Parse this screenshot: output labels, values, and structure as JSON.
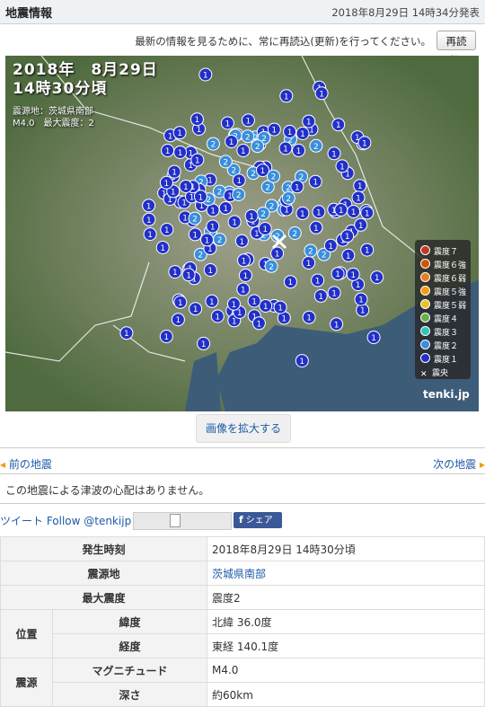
{
  "header": {
    "title": "地震情報",
    "issued": "2018年8月29日 14時34分発表"
  },
  "notice": {
    "message": "最新の情報を見るために、常に再読込(更新)を行ってください。",
    "reload_label": "再読込"
  },
  "map": {
    "date_line1": "2018年　8月29日",
    "date_line2": "14時30分頃",
    "epicenter_line": "震源地：茨城県南部",
    "magnitude_line": "M4.0　最大震度：2",
    "legend": [
      {
        "label": "震度７",
        "color": "#c0392b",
        "glyph": "7"
      },
      {
        "label": "震度６強",
        "color": "#d35400",
        "glyph": "6"
      },
      {
        "label": "震度６弱",
        "color": "#e67e22",
        "glyph": "6"
      },
      {
        "label": "震度５強",
        "color": "#f39c12",
        "glyph": "5"
      },
      {
        "label": "震度５弱",
        "color": "#e6c22b",
        "glyph": "5"
      },
      {
        "label": "震度４",
        "color": "#6ab04c",
        "glyph": "4"
      },
      {
        "label": "震度３",
        "color": "#2ec4b6",
        "glyph": "3"
      },
      {
        "label": "震度２",
        "color": "#3a8edc",
        "glyph": "2"
      },
      {
        "label": "震度１",
        "color": "#2230c8",
        "glyph": "1"
      },
      {
        "label": "震央",
        "color": "#ffffff",
        "glyph": "x"
      }
    ],
    "brand": "tenki.jp"
  },
  "enlarge_label": "画像を拡大する",
  "nav": {
    "prev": "前の地震",
    "next": "次の地震"
  },
  "tsunami": "この地震による津波の心配はありません。",
  "share": {
    "tweet": "ツイート Follow @tenkijp",
    "facebook": "シェア"
  },
  "details": {
    "time_label": "発生時刻",
    "time_value": "2018年8月29日 14時30分頃",
    "epicenter_label": "震源地",
    "epicenter_value": "茨城県南部",
    "max_label": "最大震度",
    "max_value": "震度2",
    "position_label": "位置",
    "lat_label": "緯度",
    "lat_value": "北緯 36.0度",
    "lon_label": "経度",
    "lon_value": "東経 140.1度",
    "source_label": "震源",
    "mag_label": "マグニチュード",
    "mag_value": "M4.0",
    "depth_label": "深さ",
    "depth_value": "約60km"
  }
}
